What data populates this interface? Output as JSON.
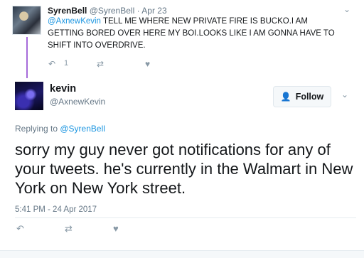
{
  "parent_tweet": {
    "display_name": "SyrenBell",
    "handle": "@SyrenBell",
    "separator": "·",
    "date": "Apr 23",
    "mention": "@AxnewKevin",
    "text": " TELL ME WHERE NEW PRIVATE FIRE IS BUCKO.I AM GETTING BORED OVER HERE MY BOI.LOOKS LIKE I AM GONNA HAVE TO SHIFT INTO OVERDRIVE.",
    "reply_count": "1"
  },
  "main_tweet": {
    "display_name": "kevin",
    "handle": "@AxnewKevin",
    "follow_label": "Follow",
    "replying_prefix": "Replying to ",
    "replying_handle": "@SyrenBell",
    "text": "sorry my guy never got notifications for any of your tweets. he's currently in the Walmart in New York on New York street.",
    "timestamp": "5:41 PM - 24 Apr 2017"
  },
  "icons": {
    "reply": "↶",
    "retweet": "⇄",
    "like": "♥",
    "chevron": "⌄",
    "follow_add_user": "👤"
  },
  "colors": {
    "link": "#1b95e0",
    "thread_line": "#a66ad9",
    "muted": "#657786",
    "icon_gray": "#8899a6"
  }
}
